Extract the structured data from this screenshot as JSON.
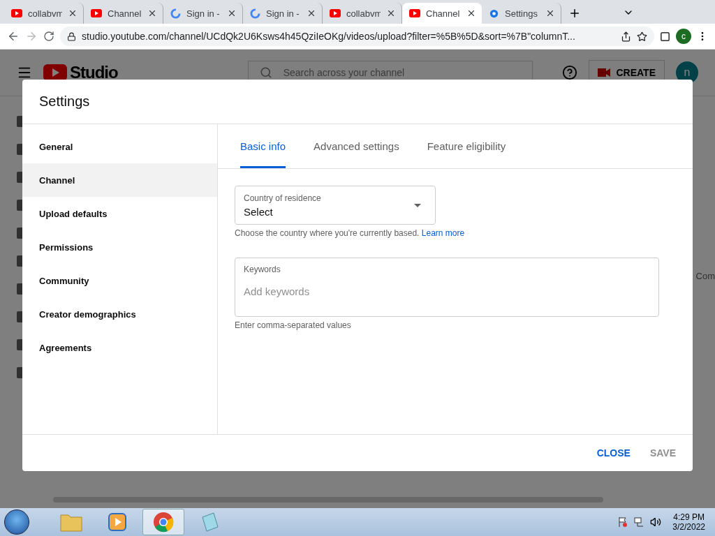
{
  "browser_tabs": [
    {
      "title": "collabvm",
      "kind": "youtube",
      "selected": false
    },
    {
      "title": "Channel",
      "kind": "youtube",
      "selected": false
    },
    {
      "title": "Sign in -",
      "kind": "google",
      "selected": false
    },
    {
      "title": "Sign in -",
      "kind": "google",
      "selected": false
    },
    {
      "title": "collabvm",
      "kind": "youtube",
      "selected": false
    },
    {
      "title": "Channel",
      "kind": "youtube",
      "selected": true
    },
    {
      "title": "Settings",
      "kind": "settings",
      "selected": false
    }
  ],
  "address_bar": {
    "url": "studio.youtube.com/channel/UCdQk2U6Ksws4h45QziIeOKg/videos/upload?filter=%5B%5D&sort=%7B\"columnT...",
    "profile_initial": "c"
  },
  "studio_header": {
    "logo_text": "Studio",
    "search_placeholder": "Search across your channel",
    "create_label": "CREATE",
    "avatar_initial": "n"
  },
  "background_text": "Com",
  "dialog": {
    "title": "Settings",
    "nav_items": [
      {
        "label": "General",
        "selected": false
      },
      {
        "label": "Channel",
        "selected": true
      },
      {
        "label": "Upload defaults",
        "selected": false
      },
      {
        "label": "Permissions",
        "selected": false
      },
      {
        "label": "Community",
        "selected": false
      },
      {
        "label": "Creator demographics",
        "selected": false
      },
      {
        "label": "Agreements",
        "selected": false
      }
    ],
    "tabs": [
      {
        "label": "Basic info",
        "selected": true
      },
      {
        "label": "Advanced settings",
        "selected": false
      },
      {
        "label": "Feature eligibility",
        "selected": false
      }
    ],
    "country": {
      "label": "Country of residence",
      "value": "Select",
      "help": "Choose the country where you're currently based.",
      "link": "Learn more"
    },
    "keywords": {
      "label": "Keywords",
      "placeholder": "Add keywords",
      "help": "Enter comma-separated values"
    },
    "buttons": [
      {
        "label": "CLOSE",
        "disabled": false
      },
      {
        "label": "SAVE",
        "disabled": true
      }
    ]
  },
  "taskbar": {
    "apps": [
      {
        "kind": "folder",
        "selected": false
      },
      {
        "kind": "media",
        "selected": false
      },
      {
        "kind": "chrome",
        "selected": true
      },
      {
        "kind": "notepad",
        "selected": false
      }
    ],
    "time": "4:29 PM",
    "date": "3/2/2022"
  }
}
